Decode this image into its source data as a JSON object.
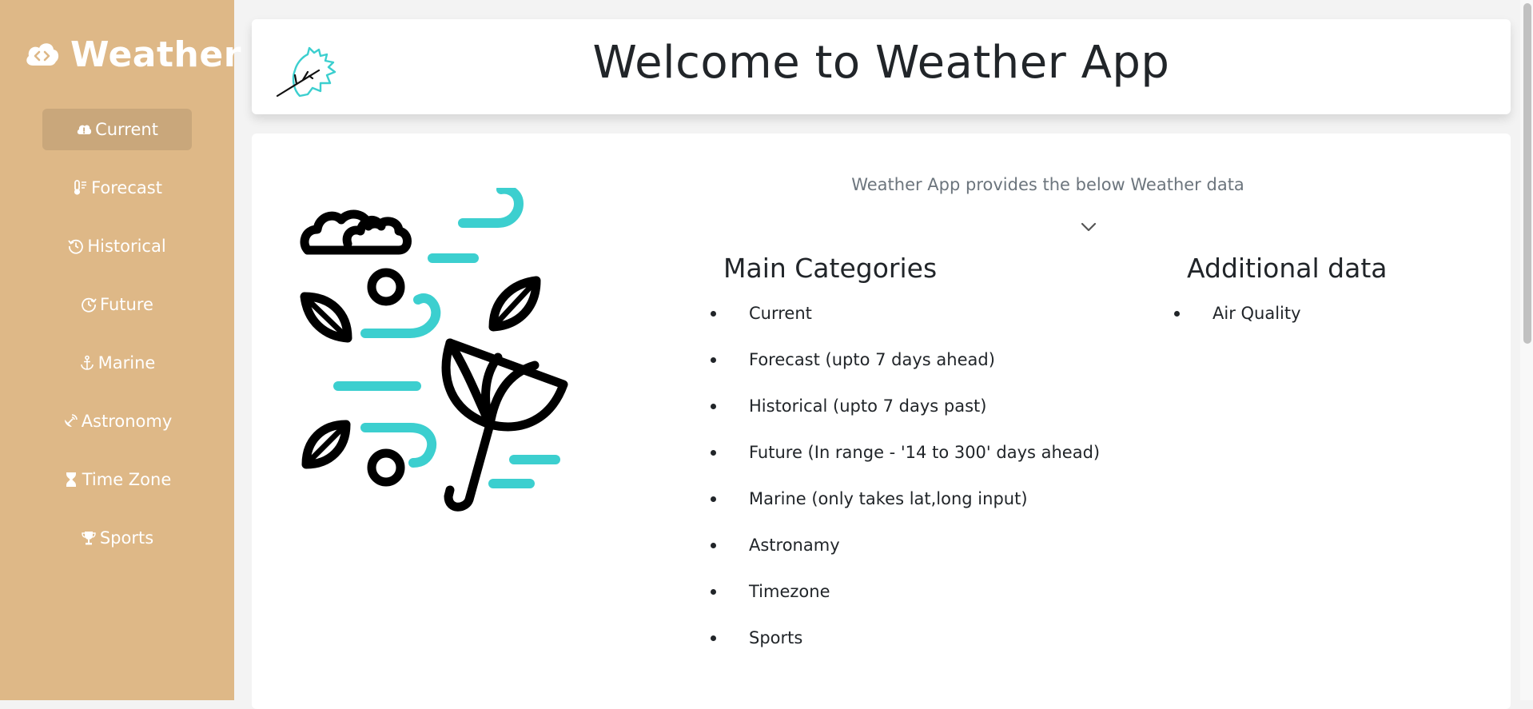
{
  "sidebar": {
    "brand": "Weather",
    "brand_icon": "cloud-code-icon",
    "items": [
      {
        "label": "Current",
        "icon": "cloud-alert-icon",
        "active": true
      },
      {
        "label": "Forecast",
        "icon": "thermometer-icon",
        "active": false
      },
      {
        "label": "Historical",
        "icon": "history-icon",
        "active": false
      },
      {
        "label": "Future",
        "icon": "clock-forward-icon",
        "active": false
      },
      {
        "label": "Marine",
        "icon": "anchor-icon",
        "active": false
      },
      {
        "label": "Astronomy",
        "icon": "satellite-dish-icon",
        "active": false
      },
      {
        "label": "Time Zone",
        "icon": "hourglass-icon",
        "active": false
      },
      {
        "label": "Sports",
        "icon": "trophy-icon",
        "active": false
      }
    ]
  },
  "header": {
    "title": "Welcome to Weather App",
    "logo_icon": "leaf-branch-icon"
  },
  "main": {
    "subtitle": "Weather App provides the below Weather data",
    "chevron_icon": "chevron-down-icon",
    "main_categories": {
      "title": "Main Categories",
      "items": [
        "Current",
        "Forecast (upto 7 days ahead)",
        "Historical (upto 7 days past)",
        "Future (In range - '14 to 300' days ahead)",
        "Marine (only takes lat,long input)",
        "Astronamy",
        "Timezone",
        "Sports"
      ]
    },
    "additional_data": {
      "title": "Additional data",
      "items": [
        "Air Quality"
      ]
    },
    "illustration_icon": "windy-weather-illustration"
  },
  "colors": {
    "sidebar_bg": "#deb887",
    "sidebar_active": "#c9a77b",
    "accent_teal": "#3ccfcf",
    "text_dark": "#212529",
    "text_muted": "#6c757d"
  }
}
